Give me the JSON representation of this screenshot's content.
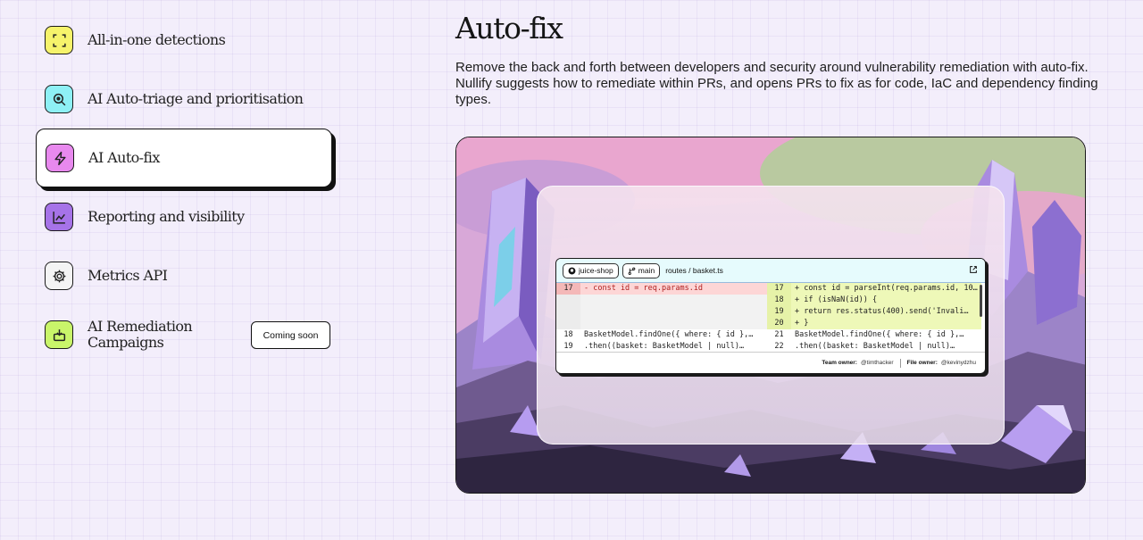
{
  "nav": {
    "items": [
      {
        "label": "All-in-one detections",
        "icon": "scan-icon",
        "color": "#f6f36b"
      },
      {
        "label": "AI Auto-triage and prioritisation",
        "icon": "search-icon",
        "color": "#8ef0f5"
      },
      {
        "label": "AI Auto-fix",
        "icon": "lightning-icon",
        "color": "#e889ee",
        "active": true
      },
      {
        "label": "Reporting and visibility",
        "icon": "chart-icon",
        "color": "#a673e8"
      },
      {
        "label": "Metrics API",
        "icon": "gear-icon",
        "color": "#f4f4f4"
      },
      {
        "label": "AI Remediation Campaigns",
        "icon": "inbox-icon",
        "color": "#c9f56a",
        "badge": "Coming soon"
      }
    ]
  },
  "content": {
    "title": "Auto-fix",
    "description": "Remove the back and forth between developers and security around vulnerability remediation with auto-fix. Nullify suggests how to remediate within PRs, and opens PRs to fix as for code, IaC and dependency finding types."
  },
  "code": {
    "repo": "juice-shop",
    "branch": "main",
    "path": "routes / basket.ts",
    "left_lines": [
      {
        "n": "17",
        "text": "- const id = req.params.id",
        "kind": "del"
      },
      {
        "n": "",
        "text": "",
        "kind": "empty"
      },
      {
        "n": "",
        "text": "",
        "kind": "empty"
      },
      {
        "n": "",
        "text": "",
        "kind": "empty"
      },
      {
        "n": "18",
        "text": "  BasketModel.findOne({ where: { id },…",
        "kind": "ctx"
      },
      {
        "n": "19",
        "text": "    .then((basket: BasketModel | null)…",
        "kind": "ctx"
      }
    ],
    "right_lines": [
      {
        "n": "17",
        "text": "+ const id = parseInt(req.params.id, 10…",
        "kind": "add"
      },
      {
        "n": "18",
        "text": "+ if (isNaN(id)) {",
        "kind": "add"
      },
      {
        "n": "19",
        "text": "+   return res.status(400).send('Invali…",
        "kind": "add"
      },
      {
        "n": "20",
        "text": "+ }",
        "kind": "add"
      },
      {
        "n": "21",
        "text": "  BasketModel.findOne({ where: { id },…",
        "kind": "ctx"
      },
      {
        "n": "22",
        "text": "    .then((basket: BasketModel | null)…",
        "kind": "ctx"
      }
    ],
    "footer": {
      "team_label": "Team owner:",
      "team_value": "@timthacker",
      "file_label": "File owner:",
      "file_value": "@kevinydzhu"
    }
  }
}
